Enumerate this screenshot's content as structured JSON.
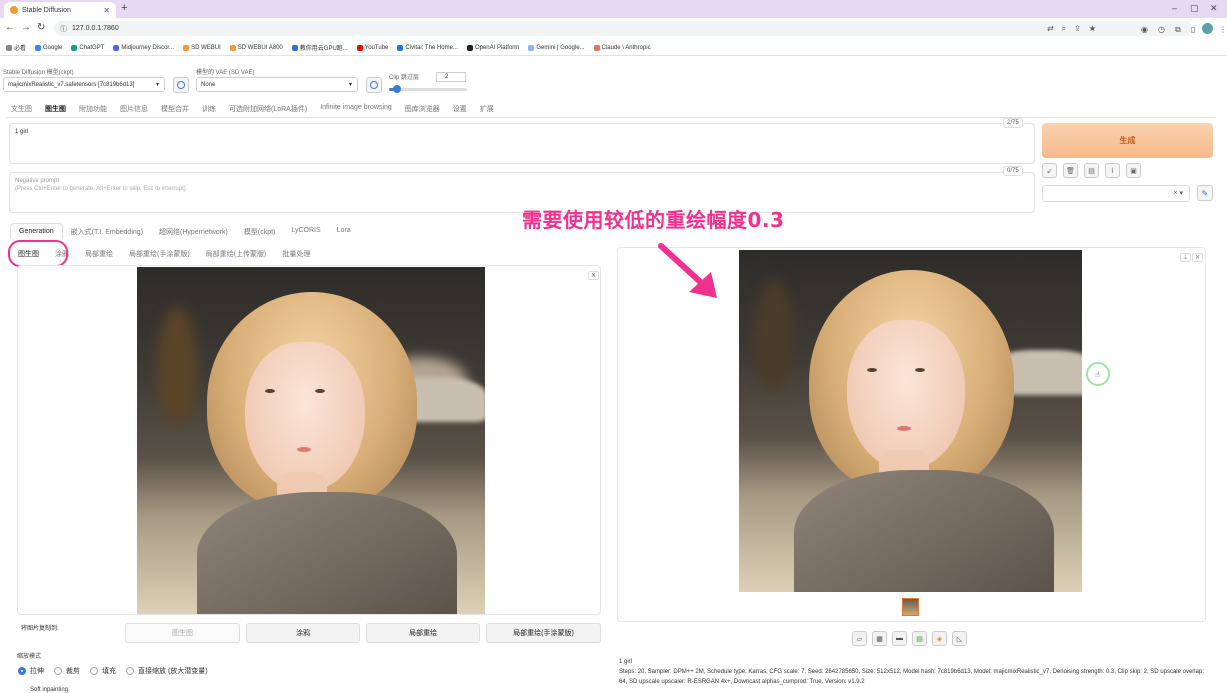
{
  "browser": {
    "tab_title": "Stable Diffusion",
    "new_tab": "+",
    "url": "127.0.0.1:7860",
    "bookmarks": [
      {
        "label": "必看",
        "color": "#888888"
      },
      {
        "label": "Google",
        "color": "#4285f4"
      },
      {
        "label": "ChatGPT",
        "color": "#10a37f"
      },
      {
        "label": "Midjourney Discor...",
        "color": "#5865f2"
      },
      {
        "label": "SD WEBUI",
        "color": "#f39a36"
      },
      {
        "label": "SD WEBUI A800",
        "color": "#f39a36"
      },
      {
        "label": "教你用云GPU跑...",
        "color": "#2f6fdb"
      },
      {
        "label": "YouTube",
        "color": "#ff0000"
      },
      {
        "label": "Civitai: The Home...",
        "color": "#1a73e8"
      },
      {
        "label": "OpenAI Platform",
        "color": "#222222"
      },
      {
        "label": "Gemini | Google...",
        "color": "#8ab4f8"
      },
      {
        "label": "Claude \\ Anthropic",
        "color": "#d97757"
      }
    ]
  },
  "settings": {
    "model_label": "Stable Diffusion 模型(ckpt)",
    "model_value": "majicmixRealistic_v7.safetensors [7c819b6d13]",
    "vae_label": "模型的 VAE (SD VAE)",
    "vae_value": "None",
    "clip_label": "Clip 跳过层",
    "clip_value": "2",
    "clip_fraction": 0.1
  },
  "main_tabs": [
    "文生图",
    "图生图",
    "附加功能",
    "图片信息",
    "模型合并",
    "训练",
    "可选附加网络(LoRA插件)",
    "Infinite image browsing",
    "图库浏览器",
    "设置",
    "扩展"
  ],
  "active_main_tab": 1,
  "prompt": {
    "positive": "1 girl",
    "positive_counter": "2/75",
    "negative_label": "Negative prompt",
    "negative_hint": "(Press Ctrl+Enter to generate, Alt+Enter to skip, Esc to interrupt)",
    "negative_counter": "0/75"
  },
  "generate_label": "生成",
  "extra_tabs": [
    "Generation",
    "嵌入式(T.I. Embedding)",
    "超网络(Hypernetwork)",
    "模型(ckpt)",
    "LyCORIS",
    "Lora"
  ],
  "sub_tabs": [
    "图生图",
    "涂鸦",
    "局部重绘",
    "局部重绘(手涂蒙版)",
    "局部重绘(上传蒙版)",
    "批量处理"
  ],
  "copy_image_label": "将图片复制到:",
  "copy_buttons": [
    "图生图",
    "涂鸦",
    "局部重绘",
    "局部重绘(手涂蒙版)"
  ],
  "resize_label": "缩放模式",
  "resize_options": [
    "拉伸",
    "裁剪",
    "填充",
    "直接缩放 (放大潜变量)"
  ],
  "soft_inpainting": "Soft inpainting",
  "annotation": "需要使用较低的重绘幅度0.3",
  "output": {
    "prompt_line": "1 girl",
    "info_line": "Steps: 20, Sampler: DPM++ 2M, Schedule type: Karras, CFG scale: 7, Seed: 2642785650, Size: 512x512, Model hash: 7c819b6d13, Model: majicmixRealistic_v7, Denoising strength: 0.3, Clip skip: 2, SD upscale overlap: 64, SD upscale upscaler: R-ESRGAN 4x+, Downcast alphas_cumprod: True, Version: v1.9.2"
  },
  "colors": {
    "accent": "#f0318e",
    "generate_bg": "#f5b98a",
    "primary": "#3a7bd5"
  }
}
